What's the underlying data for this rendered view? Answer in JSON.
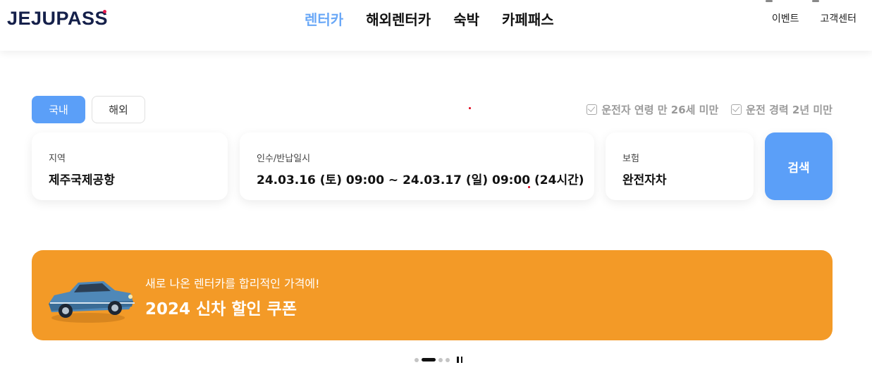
{
  "header": {
    "logo": "JEJUPASS",
    "nav": [
      "렌터카",
      "해외렌터카",
      "숙박",
      "카페패스"
    ],
    "active_nav": "렌터카",
    "util": [
      "이벤트",
      "고객센터"
    ]
  },
  "search": {
    "toggle": {
      "domestic": "국내",
      "overseas": "해외",
      "selected": "국내"
    },
    "conditions": [
      "운전자 연령 만 26세 미만",
      "운전 경력 2년 미만"
    ],
    "region": {
      "label": "지역",
      "value": "제주국제공항"
    },
    "dates": {
      "label": "인수/반납일시",
      "value": "24.03.16 (토) 09:00 ~ 24.03.17 (일) 09:00 (24시간)"
    },
    "insurance": {
      "label": "보험",
      "value": "완전자차"
    },
    "button": "검색"
  },
  "banner": {
    "subtitle": "새로 나온 렌터카를 합리적인 가격에!",
    "title": "2024 신차 할인 쿠폰",
    "background": "#f39a27"
  },
  "pager": {
    "total": 4,
    "current": 2
  },
  "colors": {
    "accent": "#5b9ff8",
    "nav_active": "#6aa8f7",
    "logo": "#15204a"
  }
}
